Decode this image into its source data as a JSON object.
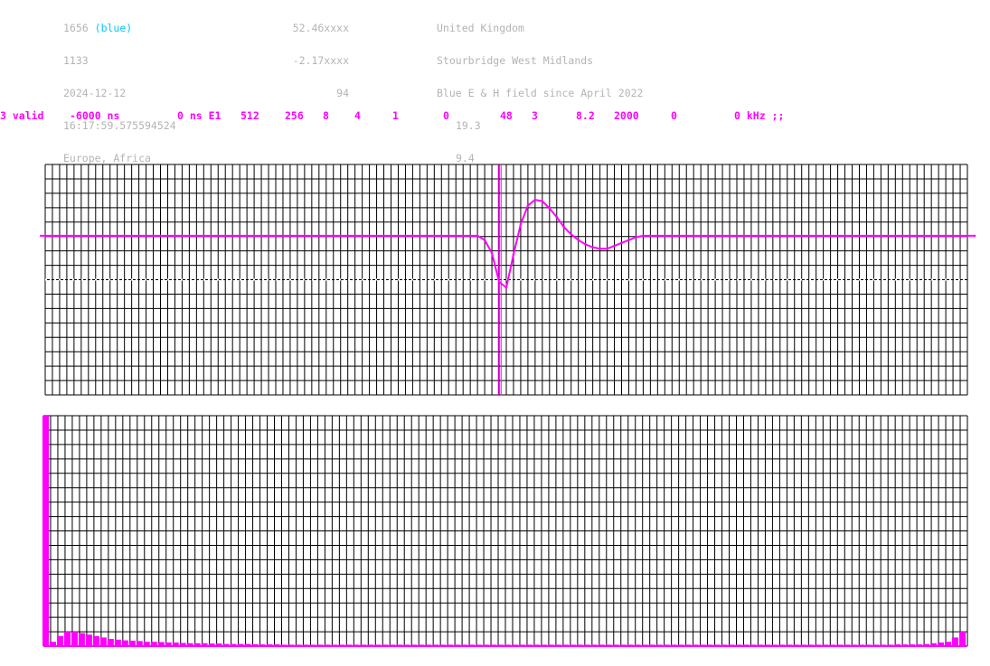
{
  "header": {
    "col1": {
      "station_id": "1656",
      "station_color_label": "(blue)",
      "line2": "1133",
      "date": "2024-12-12",
      "time": "16:17:59.575594524",
      "region": "Europe, Africa"
    },
    "col2": {
      "lat": "52.46xxxx",
      "lon": "-2.17xxxx",
      "value": "94"
    },
    "col3": {
      "country": "United Kingdom",
      "location": "Stourbridge West Midlands",
      "description": "Blue E & H field since April 2022",
      "v1": "19.3",
      "v2": "9.4"
    }
  },
  "params": [
    "3 valid",
    "-6000 ns",
    "0 ns E1",
    "512",
    "256",
    "8",
    "4",
    "1",
    "0",
    "48",
    "3",
    "8.2",
    "2000",
    "0",
    "0 kHz ;;"
  ],
  "colors": {
    "trace": "#ff00ff",
    "grid": "#000000",
    "label": "#b4b4b4",
    "accent": "#00c8ff"
  },
  "chart_data": [
    {
      "type": "line",
      "x_divisions": 128,
      "y_divisions": 16,
      "baseline_level": 0,
      "series": [
        {
          "values": [
            0,
            0,
            0,
            0,
            0,
            0,
            0,
            0,
            0,
            0,
            0,
            0,
            0,
            0,
            0,
            0,
            0,
            0,
            0,
            0,
            0,
            0,
            0,
            0,
            0,
            0,
            0,
            0,
            0,
            0,
            0,
            0,
            0,
            0,
            0,
            0,
            0,
            0,
            0,
            0,
            0,
            0,
            0,
            0,
            0,
            0,
            0,
            0,
            0,
            0,
            0,
            0,
            0,
            0,
            0,
            0,
            0,
            0,
            0,
            0,
            0,
            -0.3,
            -1.2,
            -3.2,
            -3.6,
            -1.3,
            0.8,
            2.1,
            2.5,
            2.4,
            1.9,
            1.3,
            0.6,
            0.1,
            -0.3,
            -0.6,
            -0.8,
            -0.9,
            -0.9,
            -0.7,
            -0.5,
            -0.3,
            -0.1,
            0,
            0,
            0,
            0,
            0,
            0,
            0,
            0,
            0,
            0,
            0,
            0,
            0,
            0,
            0,
            0,
            0,
            0,
            0,
            0,
            0,
            0,
            0,
            0,
            0,
            0,
            0,
            0,
            0,
            0,
            0,
            0,
            0,
            0,
            0,
            0,
            0,
            0,
            0,
            0,
            0,
            0,
            0,
            0,
            0,
            0,
            0
          ]
        }
      ],
      "marker_division": 62.9
    },
    {
      "type": "bar",
      "x_divisions": 128,
      "y_divisions": 16,
      "values": [
        16,
        0.3,
        0.7,
        1,
        1,
        0.9,
        0.8,
        0.7,
        0.6,
        0.5,
        0.45,
        0.4,
        0.38,
        0.35,
        0.3,
        0.3,
        0.28,
        0.25,
        0.25,
        0.22,
        0.2,
        0.2,
        0.2,
        0.18,
        0.18,
        0.15,
        0.15,
        0.15,
        0.15,
        0.13,
        0.12,
        0.12,
        0.12,
        0.1,
        0.1,
        0.1,
        0.1,
        0.1,
        0.1,
        0.1,
        0.1,
        0.1,
        0.1,
        0.1,
        0.1,
        0.1,
        0.1,
        0.1,
        0.1,
        0.1,
        0.1,
        0.1,
        0.1,
        0.1,
        0.1,
        0.1,
        0.1,
        0.1,
        0.1,
        0.1,
        0.1,
        0.1,
        0.1,
        0.1,
        0.1,
        0.1,
        0.1,
        0.1,
        0.1,
        0.1,
        0.1,
        0.1,
        0.1,
        0.1,
        0.1,
        0.1,
        0.1,
        0.1,
        0.1,
        0.1,
        0.1,
        0.1,
        0.1,
        0.1,
        0.1,
        0.1,
        0.1,
        0.1,
        0.1,
        0.1,
        0.1,
        0.1,
        0.1,
        0.1,
        0.1,
        0.1,
        0.1,
        0.1,
        0.1,
        0.1,
        0.1,
        0.1,
        0.1,
        0.1,
        0.1,
        0.1,
        0.1,
        0.1,
        0.1,
        0.1,
        0.1,
        0.1,
        0.1,
        0.1,
        0.1,
        0.1,
        0.1,
        0.1,
        0.12,
        0.12,
        0.12,
        0.12,
        0.15,
        0.2,
        0.25,
        0.3,
        0.6,
        1
      ]
    }
  ]
}
